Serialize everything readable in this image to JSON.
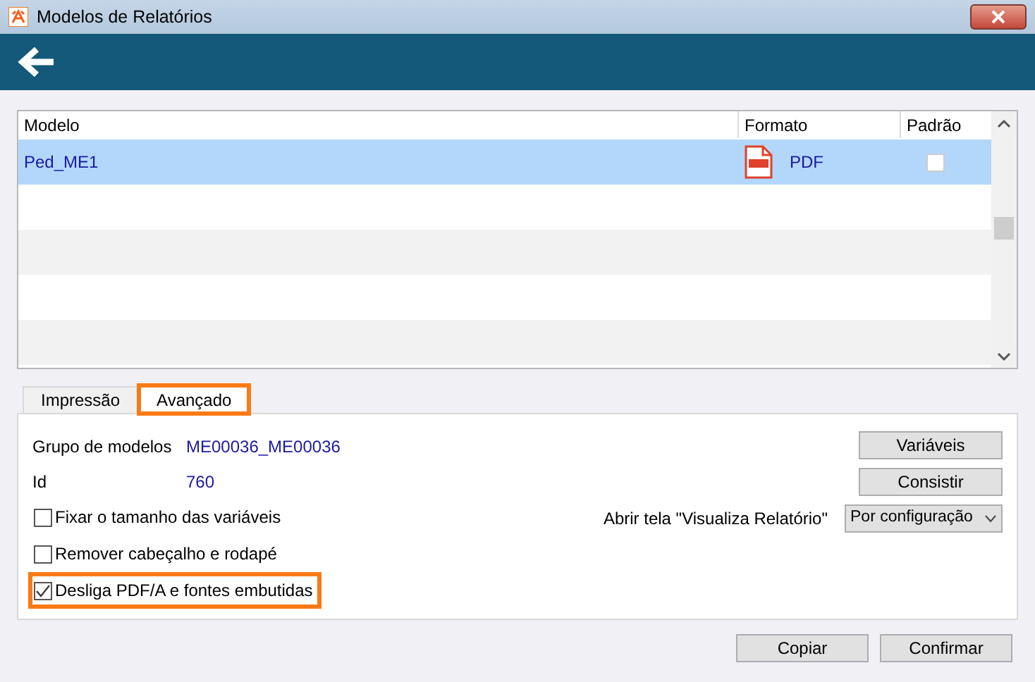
{
  "window": {
    "title": "Modelos de Relatórios"
  },
  "table": {
    "columns": [
      "Modelo",
      "Formato",
      "Padrão"
    ],
    "rows": [
      {
        "modelo": "Ped_ME1",
        "formato": "PDF",
        "padrao": false,
        "selected": true
      }
    ]
  },
  "tabs": [
    {
      "label": "Impressão",
      "selected": false,
      "highlighted": false
    },
    {
      "label": "Avançado",
      "selected": true,
      "highlighted": true
    }
  ],
  "fields": [
    {
      "label": "Grupo de modelos",
      "value": "ME00036_ME00036"
    },
    {
      "label": "Id",
      "value": "760"
    }
  ],
  "checkboxes": [
    {
      "label": "Fixar o tamanho das variáveis",
      "checked": false,
      "highlighted": false
    },
    {
      "label": "Remover cabeçalho e rodapé",
      "checked": false,
      "highlighted": false
    },
    {
      "label": "Desliga PDF/A e fontes embutidas",
      "checked": true,
      "highlighted": true
    }
  ],
  "side_buttons": [
    "Variáveis",
    "Consistir"
  ],
  "viewer": {
    "label": "Abrir tela \"Visualiza Relatório\"",
    "value": "Por configuração"
  },
  "buttons": [
    "Copiar",
    "Confirmar"
  ]
}
